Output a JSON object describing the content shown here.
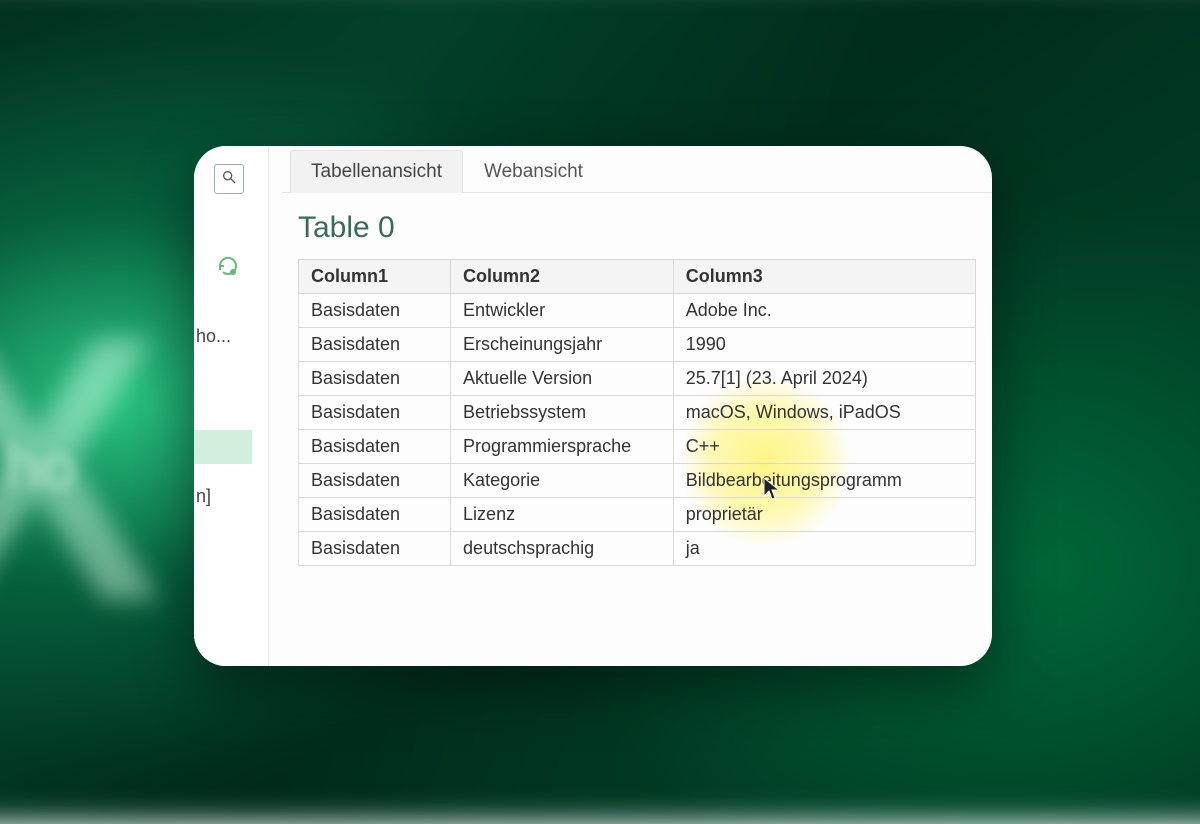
{
  "sidebar": {
    "fragment_a": "ho...",
    "fragment_b": "n]"
  },
  "tabs": {
    "table_view": "Tabellenansicht",
    "web_view": "Webansicht"
  },
  "title": "Table 0",
  "table": {
    "headers": {
      "c1": "Column1",
      "c2": "Column2",
      "c3": "Column3"
    },
    "rows": [
      {
        "c1": "Basisdaten",
        "c2": "Entwickler",
        "c3": "Adobe Inc."
      },
      {
        "c1": "Basisdaten",
        "c2": "Erscheinungsjahr",
        "c3": "1990"
      },
      {
        "c1": "Basisdaten",
        "c2": "Aktuelle Version",
        "c3": "25.7[1] (23. April 2024)"
      },
      {
        "c1": "Basisdaten",
        "c2": "Betriebssystem",
        "c3": "macOS, Windows, iPadOS"
      },
      {
        "c1": "Basisdaten",
        "c2": "Programmiersprache",
        "c3": "C++"
      },
      {
        "c1": "Basisdaten",
        "c2": "Kategorie",
        "c3": "Bildbearbeitungsprogramm"
      },
      {
        "c1": "Basisdaten",
        "c2": "Lizenz",
        "c3": "proprietär"
      },
      {
        "c1": "Basisdaten",
        "c2": "deutschsprachig",
        "c3": "ja"
      }
    ]
  }
}
